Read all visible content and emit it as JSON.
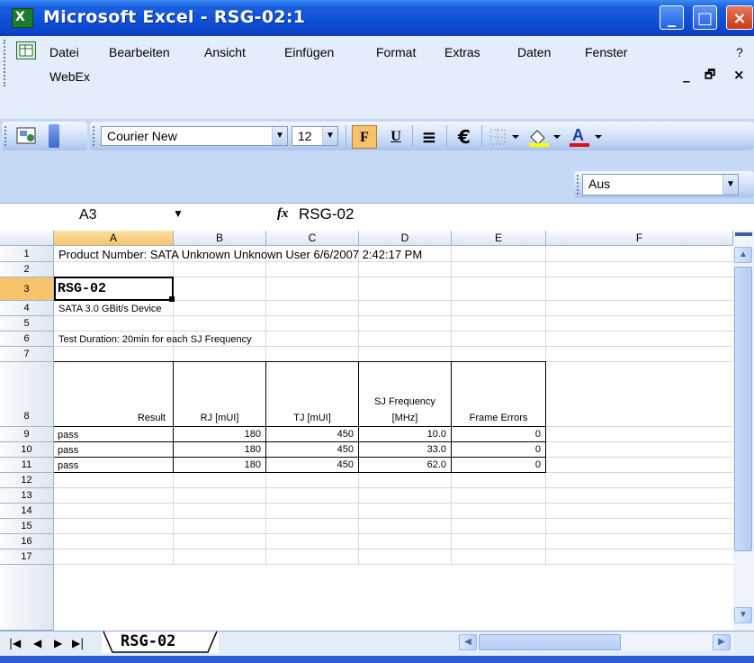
{
  "window": {
    "title": "Microsoft Excel - RSG-02:1",
    "app_icon_glyph": "X",
    "controls": {
      "minimize": "_",
      "maximize": "□",
      "close": "×"
    }
  },
  "menu": {
    "items": [
      "Datei",
      "Bearbeiten",
      "Ansicht",
      "Einfügen",
      "Format",
      "Extras",
      "Daten",
      "Fenster",
      "?"
    ],
    "second_row": [
      "WebEx"
    ],
    "mdi_controls": {
      "minimize": "_",
      "restore": "🗗",
      "close": "×"
    }
  },
  "format_toolbar": {
    "font_name": "Courier New",
    "font_size": "12",
    "bold": "F",
    "underline": "U",
    "euro": "€",
    "align_icon": "≡"
  },
  "toolbar2": {
    "dropdown_value": "Aus"
  },
  "formula_bar": {
    "cell_ref": "A3",
    "fx": "fx",
    "content": "RSG-02"
  },
  "sheet": {
    "columns": [
      "A",
      "B",
      "C",
      "D",
      "E",
      "F"
    ],
    "selected_column": "A",
    "rows": [
      "1",
      "2",
      "3",
      "4",
      "5",
      "6",
      "7",
      "8",
      "9",
      "10",
      "11",
      "12",
      "13",
      "14",
      "15",
      "16",
      "17"
    ],
    "selected_row": "3",
    "cells": {
      "a1": "Product Number: SATA   Unknown  Unknown User  6/6/2007 2:42:17 PM",
      "a3": "RSG-02",
      "a4": "SATA 3.0 GBit/s Device",
      "a6": "Test Duration: 20min for each SJ Frequency"
    },
    "table": {
      "headers": [
        "Result",
        "RJ [mUI]",
        "TJ [mUI]",
        "SJ Frequency [MHz]",
        "Frame Errors"
      ],
      "sj_header_line1": "SJ Frequency",
      "sj_header_line2": "[MHz]",
      "rows": [
        [
          "pass",
          "180",
          "450",
          "10.0",
          "0"
        ],
        [
          "pass",
          "180",
          "450",
          "33.0",
          "0"
        ],
        [
          "pass",
          "180",
          "450",
          "62.0",
          "0"
        ]
      ]
    }
  },
  "sheet_tabs": {
    "active": "RSG-02"
  },
  "colors": {
    "titlebar": "#0e4fd6",
    "selected_header": "#f6c36b",
    "grid_line": "#d0d7e5"
  }
}
